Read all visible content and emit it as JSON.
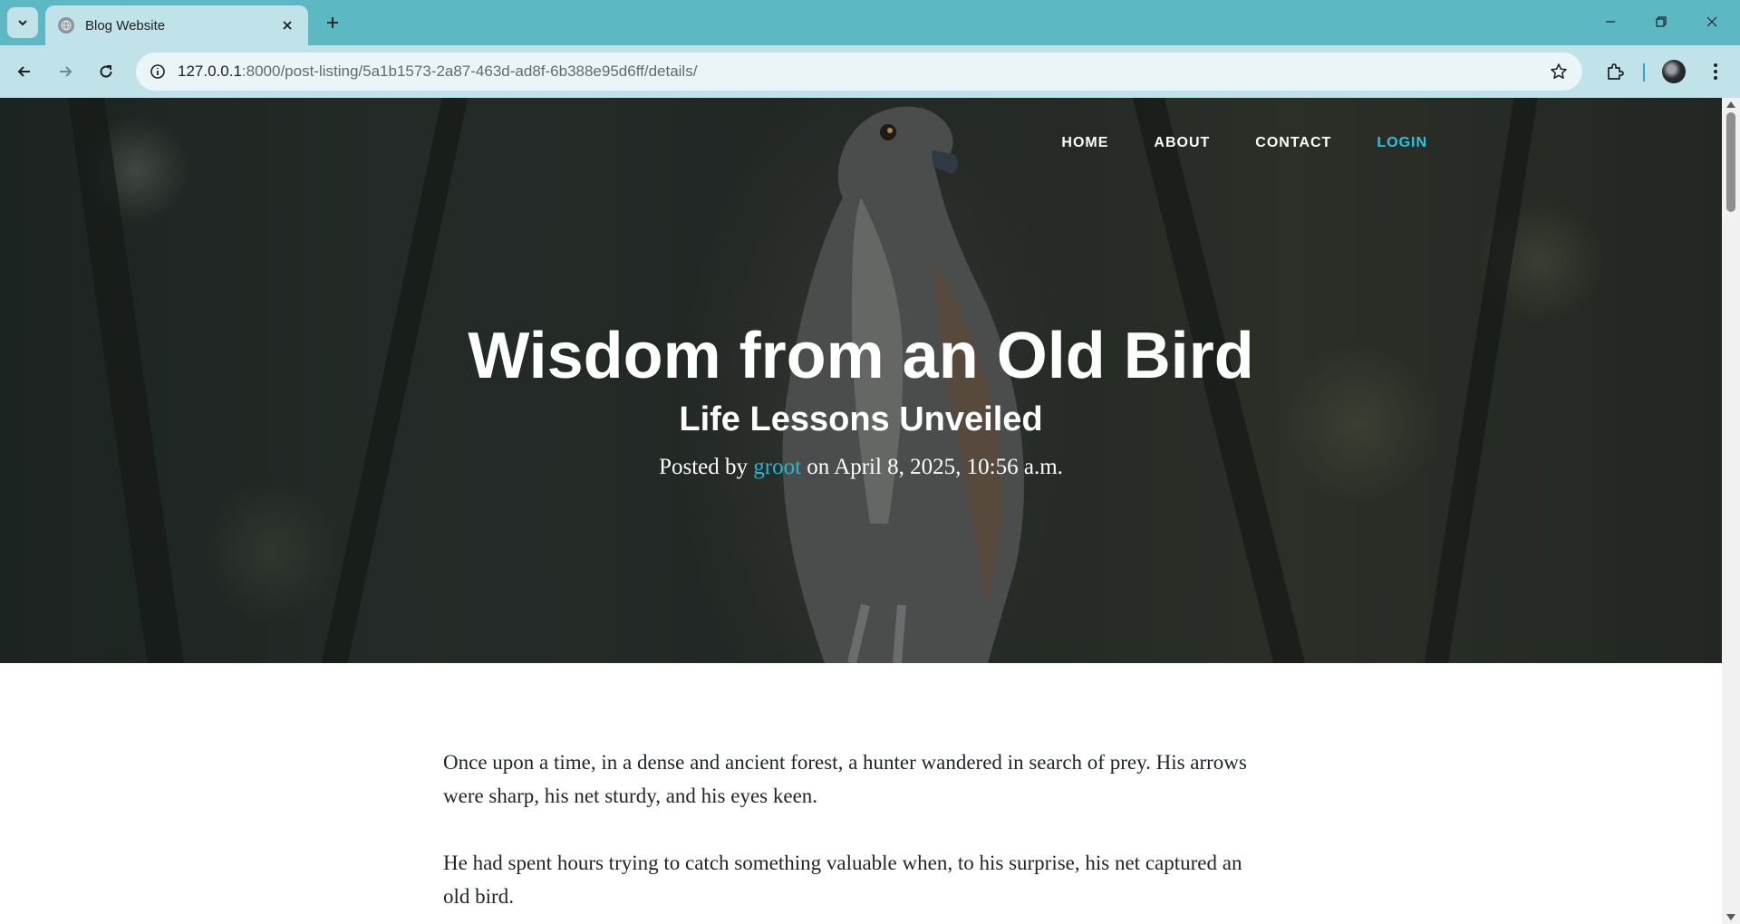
{
  "browser": {
    "tab_title": "Blog Website",
    "url_host": "127.0.0.1",
    "url_rest": ":8000/post-listing/5a1b1573-2a87-463d-ad8f-6b388e95d6ff/details/"
  },
  "nav": {
    "home": "HOME",
    "about": "ABOUT",
    "contact": "CONTACT",
    "login": "LOGIN"
  },
  "post": {
    "title": "Wisdom from an Old Bird",
    "subtitle": "Life Lessons Unveiled",
    "meta_prefix": "Posted by",
    "author": "groot",
    "meta_suffix": "on April 8, 2025, 10:56 a.m.",
    "paragraphs": [
      "Once upon a time, in a dense and ancient forest, a hunter wandered in search of prey. His arrows were sharp, his net sturdy, and his eyes keen.",
      "He had spent hours trying to catch something valuable when, to his surprise, his net captured an old bird."
    ]
  },
  "colors": {
    "accent": "#25c6e0",
    "chrome": "#5cb8c2",
    "toolbar": "#bfe3e8"
  }
}
